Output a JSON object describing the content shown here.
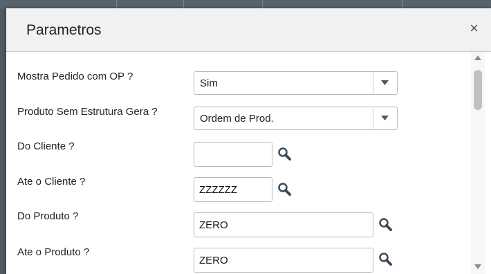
{
  "dialog": {
    "title": "Parametros",
    "close_glyph": "×"
  },
  "params": [
    {
      "label": "Mostra Pedido com OP ?",
      "type": "select",
      "value": "Sim"
    },
    {
      "label": "Produto Sem Estrutura Gera ?",
      "type": "select",
      "value": "Ordem de Prod."
    },
    {
      "label": "Do  Cliente ?",
      "type": "lookup",
      "value": ""
    },
    {
      "label": "Ate o Cliente ?",
      "type": "lookup",
      "value": "ZZZZZZ"
    },
    {
      "label": "Do  Produto ?",
      "type": "lookup",
      "value": "ZERO"
    },
    {
      "label": "Ate o Produto ?",
      "type": "lookup",
      "value": "ZERO"
    }
  ],
  "icons": {
    "dropdown": "chevron-down-icon",
    "lookup": "search-icon",
    "close": "close-icon"
  },
  "colors": {
    "titlebar": "#f1f1f1",
    "border": "#b9b9b9",
    "backdrop": "#4d5963"
  }
}
